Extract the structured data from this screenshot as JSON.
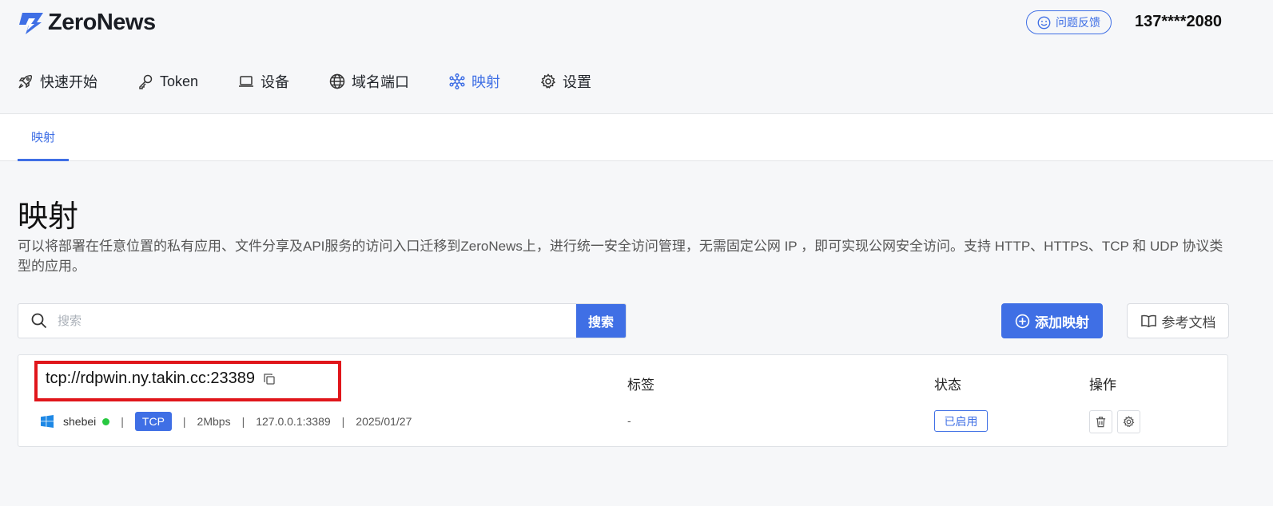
{
  "app": {
    "logo_text": "ZeroNews",
    "feedback_label": "问题反馈",
    "user_phone": "137****2080",
    "brand_color": "#3f6fe5"
  },
  "nav": {
    "items": [
      {
        "label": "快速开始",
        "icon": "rocket-icon"
      },
      {
        "label": "Token",
        "icon": "key-icon"
      },
      {
        "label": "设备",
        "icon": "laptop-icon"
      },
      {
        "label": "域名端口",
        "icon": "globe-icon"
      },
      {
        "label": "映射",
        "icon": "network-icon",
        "active": true
      },
      {
        "label": "设置",
        "icon": "gear-icon"
      }
    ]
  },
  "subtabs": {
    "active": "映射"
  },
  "page": {
    "title": "映射",
    "description": "可以将部署在任意位置的私有应用、文件分享及API服务的访问入口迁移到ZeroNews上，进行统一安全访问管理，无需固定公网 IP ，即可实现公网安全访问。支持 HTTP、HTTPS、TCP 和 UDP 协议类型的应用。"
  },
  "search": {
    "placeholder": "搜索",
    "value": "",
    "button_label": "搜索"
  },
  "actions": {
    "add_label": "添加映射",
    "docs_label": "参考文档"
  },
  "table": {
    "headers": {
      "tag": "标签",
      "status": "状态",
      "ops": "操作"
    },
    "rows": [
      {
        "address": "tcp://rdpwin.ny.takin.cc:23389",
        "device": "shebei",
        "device_online": true,
        "protocol": "TCP",
        "bandwidth": "2Mbps",
        "local": "127.0.0.1:3389",
        "date": "2025/01/27",
        "tag": "-",
        "status": "已启用"
      }
    ]
  }
}
